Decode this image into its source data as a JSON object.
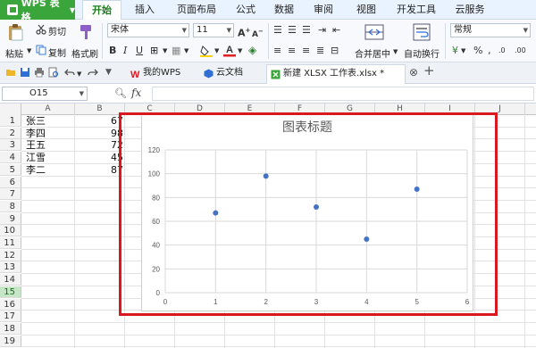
{
  "app": {
    "name": "WPS 表格"
  },
  "menu_tabs": [
    {
      "label": "开始",
      "active": true
    },
    {
      "label": "插入"
    },
    {
      "label": "页面布局"
    },
    {
      "label": "公式"
    },
    {
      "label": "数据"
    },
    {
      "label": "审阅"
    },
    {
      "label": "视图"
    },
    {
      "label": "开发工具"
    },
    {
      "label": "云服务"
    }
  ],
  "ribbon": {
    "paste": "粘贴",
    "cut": "剪切",
    "copy": "复制",
    "format_painter": "格式刷",
    "font_name": "宋体",
    "font_size": "11",
    "merge_center": "合并居中",
    "wrap_text": "自动换行",
    "number_format": "常规"
  },
  "doc_tabs": [
    {
      "label": "我的WPS"
    },
    {
      "label": "云文档"
    },
    {
      "label": "新建 XLSX 工作表.xlsx *",
      "active": true
    }
  ],
  "formula_bar": {
    "cell_ref": "O15",
    "fx": "fx"
  },
  "grid": {
    "columns": [
      "A",
      "B",
      "C",
      "D",
      "E",
      "F",
      "G",
      "H",
      "I",
      "J"
    ],
    "rows": [
      "1",
      "2",
      "3",
      "4",
      "5",
      "6",
      "7",
      "8",
      "9",
      "10",
      "11",
      "12",
      "13",
      "14",
      "15",
      "16",
      "17",
      "18",
      "19"
    ],
    "selected_row": "15",
    "names": [
      "张三",
      "李四",
      "王五",
      "江雪",
      "李二"
    ],
    "values_visible": [
      "67",
      "98",
      "72",
      "45",
      "87"
    ]
  },
  "chart_data": {
    "type": "scatter",
    "title": "图表标题",
    "x": [
      1,
      2,
      3,
      4,
      5
    ],
    "y": [
      67,
      98,
      72,
      45,
      87
    ],
    "xlim": [
      0,
      6
    ],
    "ylim": [
      0,
      120
    ],
    "xticks": [
      0,
      1,
      2,
      3,
      4,
      5,
      6
    ],
    "yticks": [
      0,
      20,
      40,
      60,
      80,
      100,
      120
    ],
    "grid": true,
    "marker_color": "#4472c4"
  },
  "colors": {
    "accent": "#3aa53a",
    "highlight": "#d9191f"
  }
}
